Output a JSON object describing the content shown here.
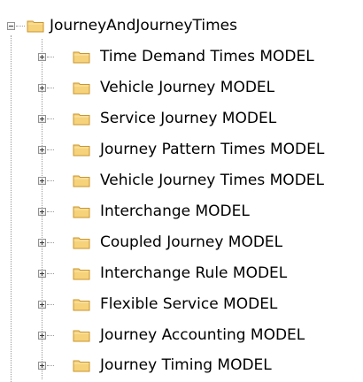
{
  "tree": {
    "root": {
      "label": "JourneyAndJourneyTimes",
      "icon": "folder-icon",
      "expanded": true
    },
    "children": [
      {
        "label": "Time Demand Times MODEL",
        "icon": "folder-icon",
        "expanded": false
      },
      {
        "label": "Vehicle Journey MODEL",
        "icon": "folder-icon",
        "expanded": false
      },
      {
        "label": "Service Journey MODEL",
        "icon": "folder-icon",
        "expanded": false
      },
      {
        "label": "Journey Pattern Times MODEL",
        "icon": "folder-icon",
        "expanded": false
      },
      {
        "label": "Vehicle Journey Times MODEL",
        "icon": "folder-icon",
        "expanded": false
      },
      {
        "label": "Interchange MODEL",
        "icon": "folder-icon",
        "expanded": false
      },
      {
        "label": "Coupled Journey MODEL",
        "icon": "folder-icon",
        "expanded": false
      },
      {
        "label": "Interchange Rule MODEL",
        "icon": "folder-icon",
        "expanded": false
      },
      {
        "label": "Flexible Service MODEL",
        "icon": "folder-icon",
        "expanded": false
      },
      {
        "label": "Journey Accounting MODEL",
        "icon": "folder-icon",
        "expanded": false
      },
      {
        "label": "Journey Timing MODEL",
        "icon": "folder-icon",
        "expanded": false
      }
    ]
  },
  "colors": {
    "folder_fill": "#f6d27a",
    "folder_stroke": "#c9962e",
    "line": "#9a9a9a",
    "text": "#000000"
  }
}
